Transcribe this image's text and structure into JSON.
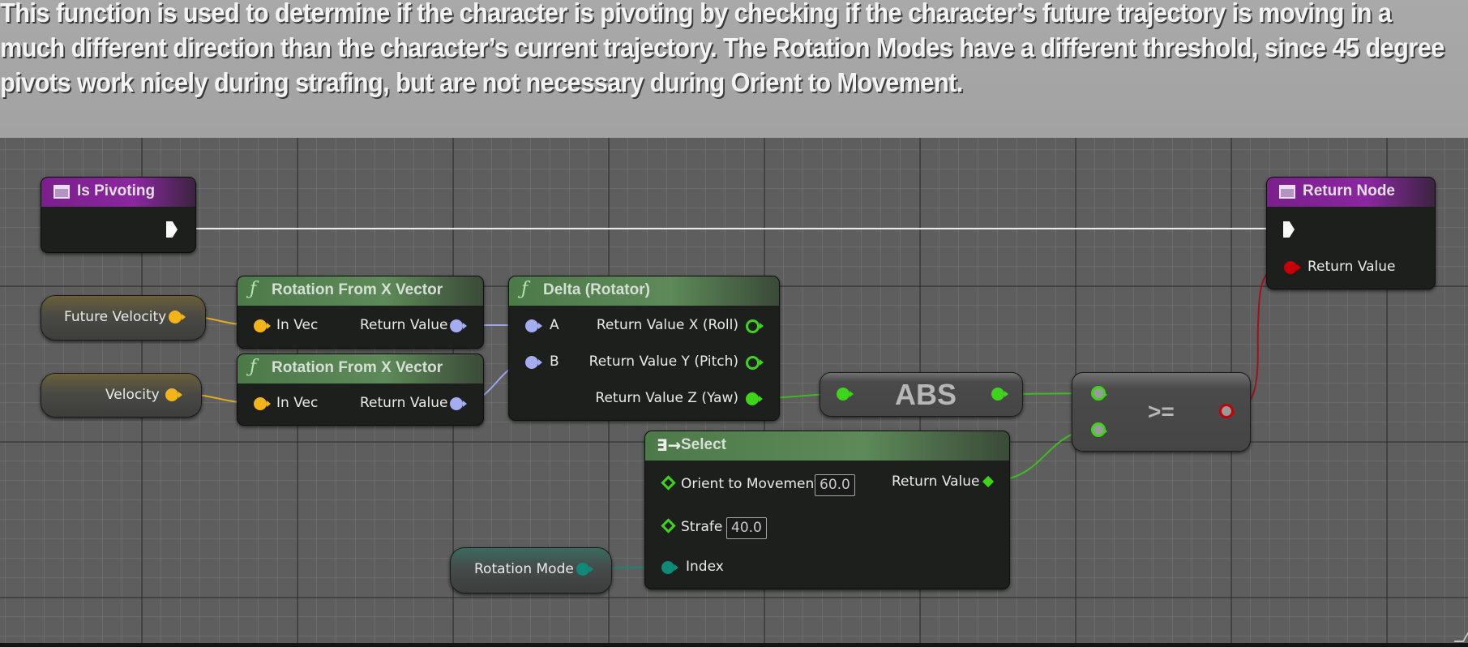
{
  "comment": {
    "text": "This function is used to determine if the character is pivoting by checking if the character’s future trajectory is moving in a much different direction than the character’s current trajectory. The Rotation Modes have a different threshold, since 45 degree pivots work nicely during strafing, but are not necessary during Orient to Movement."
  },
  "nodes": {
    "entry": {
      "title": "Is Pivoting",
      "icon": "function-entry-icon"
    },
    "return": {
      "title": "Return Node",
      "icon": "function-entry-icon",
      "return_value_label": "Return Value"
    },
    "future_velocity": {
      "label": "Future Velocity"
    },
    "velocity": {
      "label": "Velocity"
    },
    "rot_from_x_1": {
      "title": "Rotation From X Vector",
      "in_label": "In Vec",
      "out_label": "Return Value",
      "icon": "function-icon"
    },
    "rot_from_x_2": {
      "title": "Rotation From X Vector",
      "in_label": "In Vec",
      "out_label": "Return Value",
      "icon": "function-icon"
    },
    "delta": {
      "title": "Delta (Rotator)",
      "a_label": "A",
      "b_label": "B",
      "x_label": "Return Value X (Roll)",
      "y_label": "Return Value Y (Pitch)",
      "z_label": "Return Value Z (Yaw)",
      "icon": "function-icon"
    },
    "abs": {
      "title": "ABS"
    },
    "gte": {
      "title": ">="
    },
    "select": {
      "title": "Select",
      "icon": "select-icon",
      "options": [
        {
          "label": "Orient to Movement",
          "value": "60.0"
        },
        {
          "label": "Strafe",
          "value": "40.0"
        }
      ],
      "index_label": "Index",
      "return_label": "Return Value"
    },
    "rotation_mode": {
      "label": "Rotation Mode"
    }
  },
  "colors": {
    "vector_pin": "#f2b419",
    "rotator_pin": "#a5adf2",
    "float_pin": "#3ed41a",
    "bool_pin": "#c50007",
    "enum_pin": "#0f8a78",
    "exec_pin": "#fafafa",
    "entry_header": "#7a1f8c",
    "function_header": "#4c7a48"
  }
}
